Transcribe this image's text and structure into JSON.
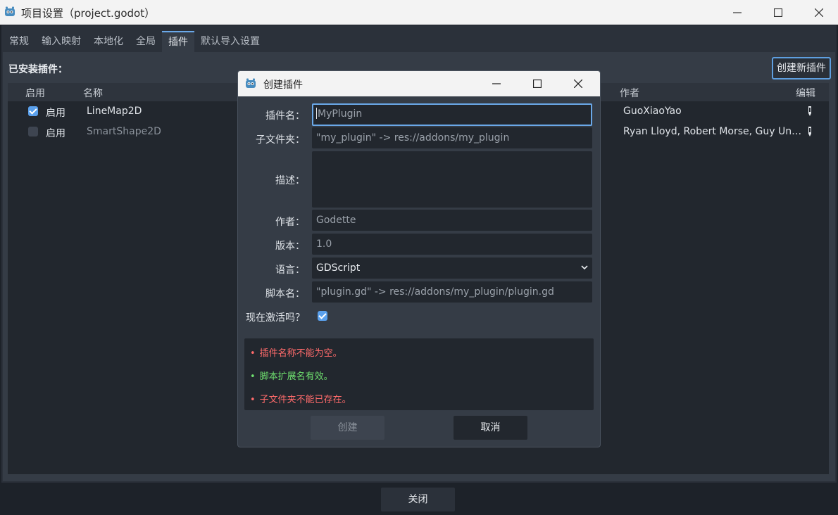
{
  "window": {
    "title": "项目设置（project.godot）"
  },
  "tabs": [
    "常规",
    "输入映射",
    "本地化",
    "全局",
    "插件",
    "默认导入设置"
  ],
  "active_tab": "插件",
  "installed_label": "已安装插件：",
  "create_new_plugin_button": "创建新插件",
  "table": {
    "columns": {
      "enabled": "启用",
      "name": "名称",
      "author": "作者",
      "edit": "编辑"
    },
    "rows": [
      {
        "enabled": true,
        "enabled_label": "启用",
        "name": "LineMap2D",
        "author": "GuoXiaoYao"
      },
      {
        "enabled": false,
        "enabled_label": "启用",
        "name": "SmartShape2D",
        "author": "Ryan Lloyd, Robert Morse, Guy Un…"
      }
    ]
  },
  "close_button": "关闭",
  "dialog": {
    "title": "创建插件",
    "fields": {
      "plugin_name": {
        "label": "插件名：",
        "placeholder": "MyPlugin",
        "value": ""
      },
      "subfolder": {
        "label": "子文件夹：",
        "placeholder": "\"my_plugin\" -> res://addons/my_plugin"
      },
      "description": {
        "label": "描述：",
        "value": ""
      },
      "author": {
        "label": "作者：",
        "placeholder": "Godette"
      },
      "version": {
        "label": "版本：",
        "placeholder": "1.0"
      },
      "language": {
        "label": "语言：",
        "value": "GDScript"
      },
      "script_name": {
        "label": "脚本名：",
        "placeholder": "\"plugin.gd\" -> res://addons/my_plugin/plugin.gd"
      },
      "activate_now": {
        "label": "现在激活吗？",
        "checked": true
      }
    },
    "messages": [
      {
        "bullet": "•",
        "text": "插件名称不能为空。",
        "color": "#ff6b6b"
      },
      {
        "bullet": "•",
        "text": "脚本扩展名有效。",
        "color": "#6fe06f"
      },
      {
        "bullet": "•",
        "text": "子文件夹不能已存在。",
        "color": "#ff6b6b"
      }
    ],
    "create_button": "创建",
    "cancel_button": "取消"
  },
  "colors": {
    "accent": "#6aa8e8",
    "error": "#ff6b6b",
    "success": "#6fe06f"
  }
}
